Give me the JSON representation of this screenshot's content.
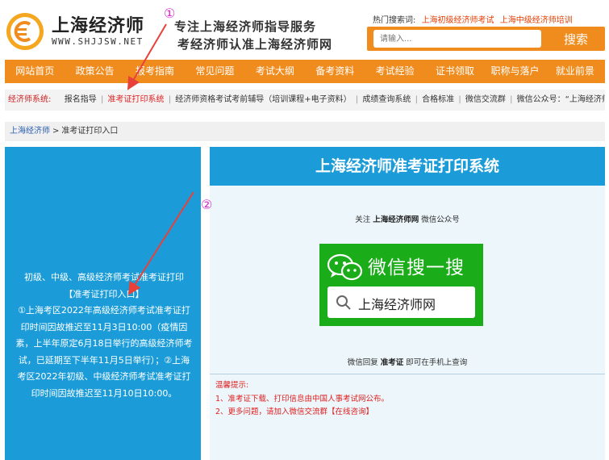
{
  "header": {
    "logo_title": "上海经济师",
    "logo_url": "WWW.SHJJSW.NET",
    "slogan_line1": "专注上海经济师指导服务",
    "slogan_line2": "考经济师认准上海经济师网",
    "hot_search_label": "热门搜索词:",
    "hot_links": [
      "上海初级经济师考试",
      "上海中级经济师培训"
    ],
    "search_placeholder": "请输入...",
    "search_button": "搜索"
  },
  "nav": {
    "items": [
      "网站首页",
      "政策公告",
      "报考指南",
      "常见问题",
      "考试大纲",
      "备考资料",
      "考试经验",
      "证书领取",
      "职称与落户",
      "就业前景"
    ]
  },
  "subbar": {
    "label": "经济师系统:",
    "links": [
      "报名指导",
      "准考证打印系统",
      "经济师资格考试考前辅导（培训课程+电子资料）",
      "成绩查询系统",
      "合格标准",
      "微信交流群",
      "微信公众号：“上海经济师网”"
    ]
  },
  "breadcrumb": {
    "home": "上海经济师",
    "separator": ">",
    "current": "准考证打印入口"
  },
  "left_panel": {
    "line1": "初级、中级、高级经济师考试准考证打印",
    "entry_link": "【准考证打印入口】",
    "notice": "①上海考区2022年高级经济师考试准考证打印时间因故推迟至11月3日10:00（疫情因素，上半年原定6月18日举行的高级经济师考试，已延期至下半年11月5日举行）；②上海考区2022年初级、中级经济师考试准考证打印时间因故推迟至11月10日10:00。"
  },
  "right_panel": {
    "title": "上海经济师准考证打印系统",
    "follow_prefix": "关注",
    "follow_name": "上海经济师网",
    "follow_suffix": "微信公众号",
    "wechat_title": "微信搜一搜",
    "wechat_search_text": "上海经济师网",
    "reply_prefix": "微信回复",
    "reply_keyword": "准考证",
    "reply_suffix": "即可在手机上查询",
    "tips_title": "温馨提示:",
    "tip1": "1、准考证下载、打印信息由中国人事考试网公布。",
    "tip2_prefix": "2、更多问题，请加入",
    "tip2_link": "微信交流群【在线咨询】"
  },
  "annotations": {
    "marker1": "①",
    "marker2": "②",
    "color": "#d92ad0",
    "arrow_color": "#e8413a"
  },
  "colors": {
    "orange": "#f08c1e",
    "blue": "#1b9cd8",
    "wechat_green": "#1aad19",
    "link_red": "#e02020"
  }
}
